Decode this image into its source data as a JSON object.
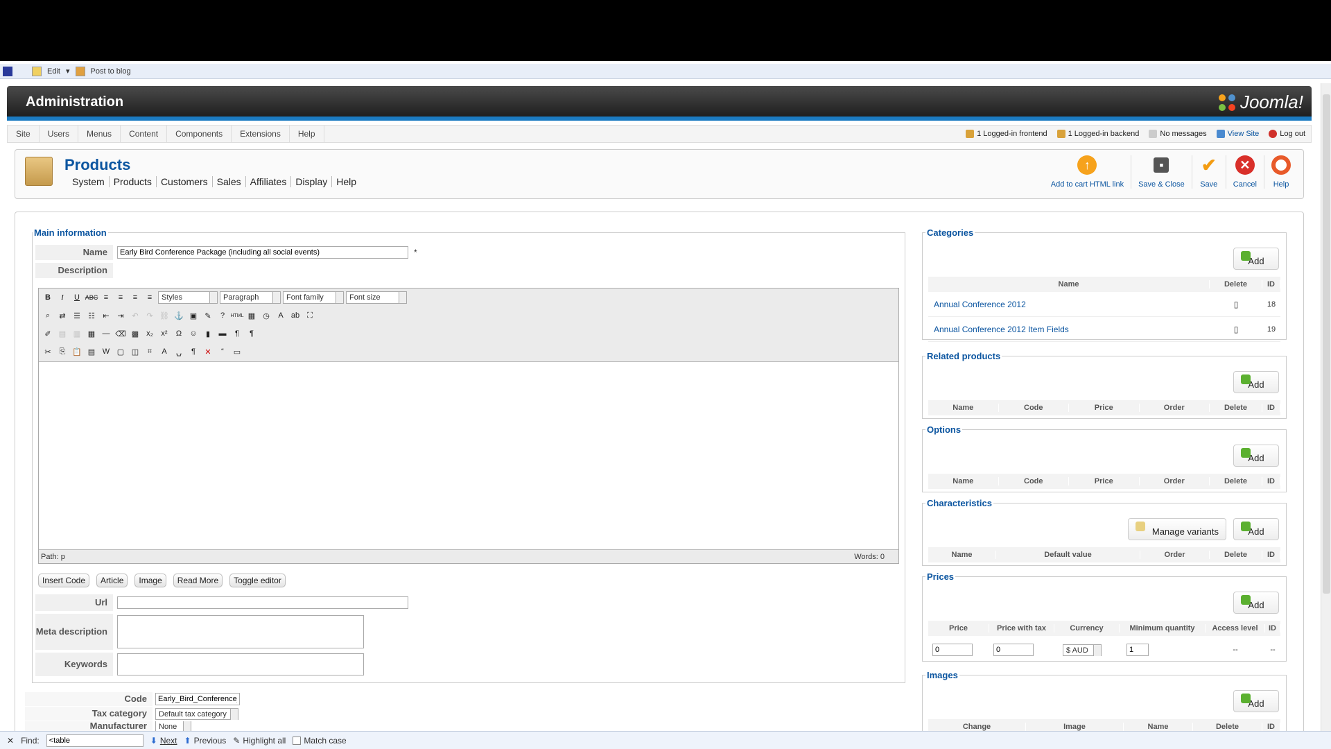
{
  "top_strip": {
    "edit_label": "Edit",
    "post_label": "Post to blog"
  },
  "header": {
    "title": "Administration",
    "logo_text": "Joomla!"
  },
  "menu": [
    "Site",
    "Users",
    "Menus",
    "Content",
    "Components",
    "Extensions",
    "Help"
  ],
  "status": {
    "frontend": "1 Logged-in frontend",
    "backend": "1 Logged-in backend",
    "messages": "No messages",
    "view_site": "View Site",
    "logout": "Log out"
  },
  "page": {
    "title": "Products",
    "submenu": [
      "System",
      "Products",
      "Customers",
      "Sales",
      "Affiliates",
      "Display",
      "Help"
    ]
  },
  "toolbar": {
    "add_to_cart": "Add to cart HTML link",
    "save_close": "Save & Close",
    "save": "Save",
    "cancel": "Cancel",
    "help": "Help"
  },
  "main_info": {
    "legend": "Main information",
    "name_label": "Name",
    "name_value": "Early Bird Conference Package (including all social events)",
    "required_mark": "*",
    "description_label": "Description",
    "editor": {
      "styles": "Styles",
      "paragraph": "Paragraph",
      "font_family": "Font family",
      "font_size": "Font size",
      "path": "Path: p",
      "words": "Words: 0"
    },
    "editor_buttons": [
      "Insert Code",
      "Article",
      "Image",
      "Read More",
      "Toggle editor"
    ],
    "url_label": "Url",
    "url_value": "",
    "meta_label": "Meta description",
    "keywords_label": "Keywords"
  },
  "lower": {
    "code_label": "Code",
    "code_value": "Early_Bird_Conference_F",
    "tax_label": "Tax category",
    "tax_value": "Default tax category",
    "manufacturer_label": "Manufacturer",
    "manufacturer_value": "None"
  },
  "categories": {
    "legend": "Categories",
    "add": "Add",
    "columns": [
      "Name",
      "Delete",
      "ID"
    ],
    "rows": [
      {
        "name": "Annual Conference 2012",
        "id": "18"
      },
      {
        "name": "Annual Conference 2012 Item Fields",
        "id": "19"
      }
    ]
  },
  "related": {
    "legend": "Related products",
    "add": "Add",
    "columns": [
      "Name",
      "Code",
      "Price",
      "Order",
      "Delete",
      "ID"
    ]
  },
  "options": {
    "legend": "Options",
    "add": "Add",
    "columns": [
      "Name",
      "Code",
      "Price",
      "Order",
      "Delete",
      "ID"
    ]
  },
  "characteristics": {
    "legend": "Characteristics",
    "manage": "Manage variants",
    "add": "Add",
    "columns": [
      "Name",
      "Default value",
      "Order",
      "Delete",
      "ID"
    ]
  },
  "prices": {
    "legend": "Prices",
    "add": "Add",
    "columns": [
      "Price",
      "Price with tax",
      "Currency",
      "Minimum quantity",
      "Access level",
      "ID"
    ],
    "row": {
      "price": "0",
      "price_tax": "0",
      "currency": "$ AUD",
      "min_qty": "1",
      "access": "--",
      "id": "--"
    }
  },
  "images": {
    "legend": "Images",
    "add": "Add",
    "columns": [
      "Change",
      "Image",
      "Name",
      "Delete",
      "ID"
    ]
  },
  "find": {
    "label": "Find:",
    "value": "<table",
    "next": "Next",
    "previous": "Previous",
    "highlight": "Highlight all",
    "match_case": "Match case"
  }
}
